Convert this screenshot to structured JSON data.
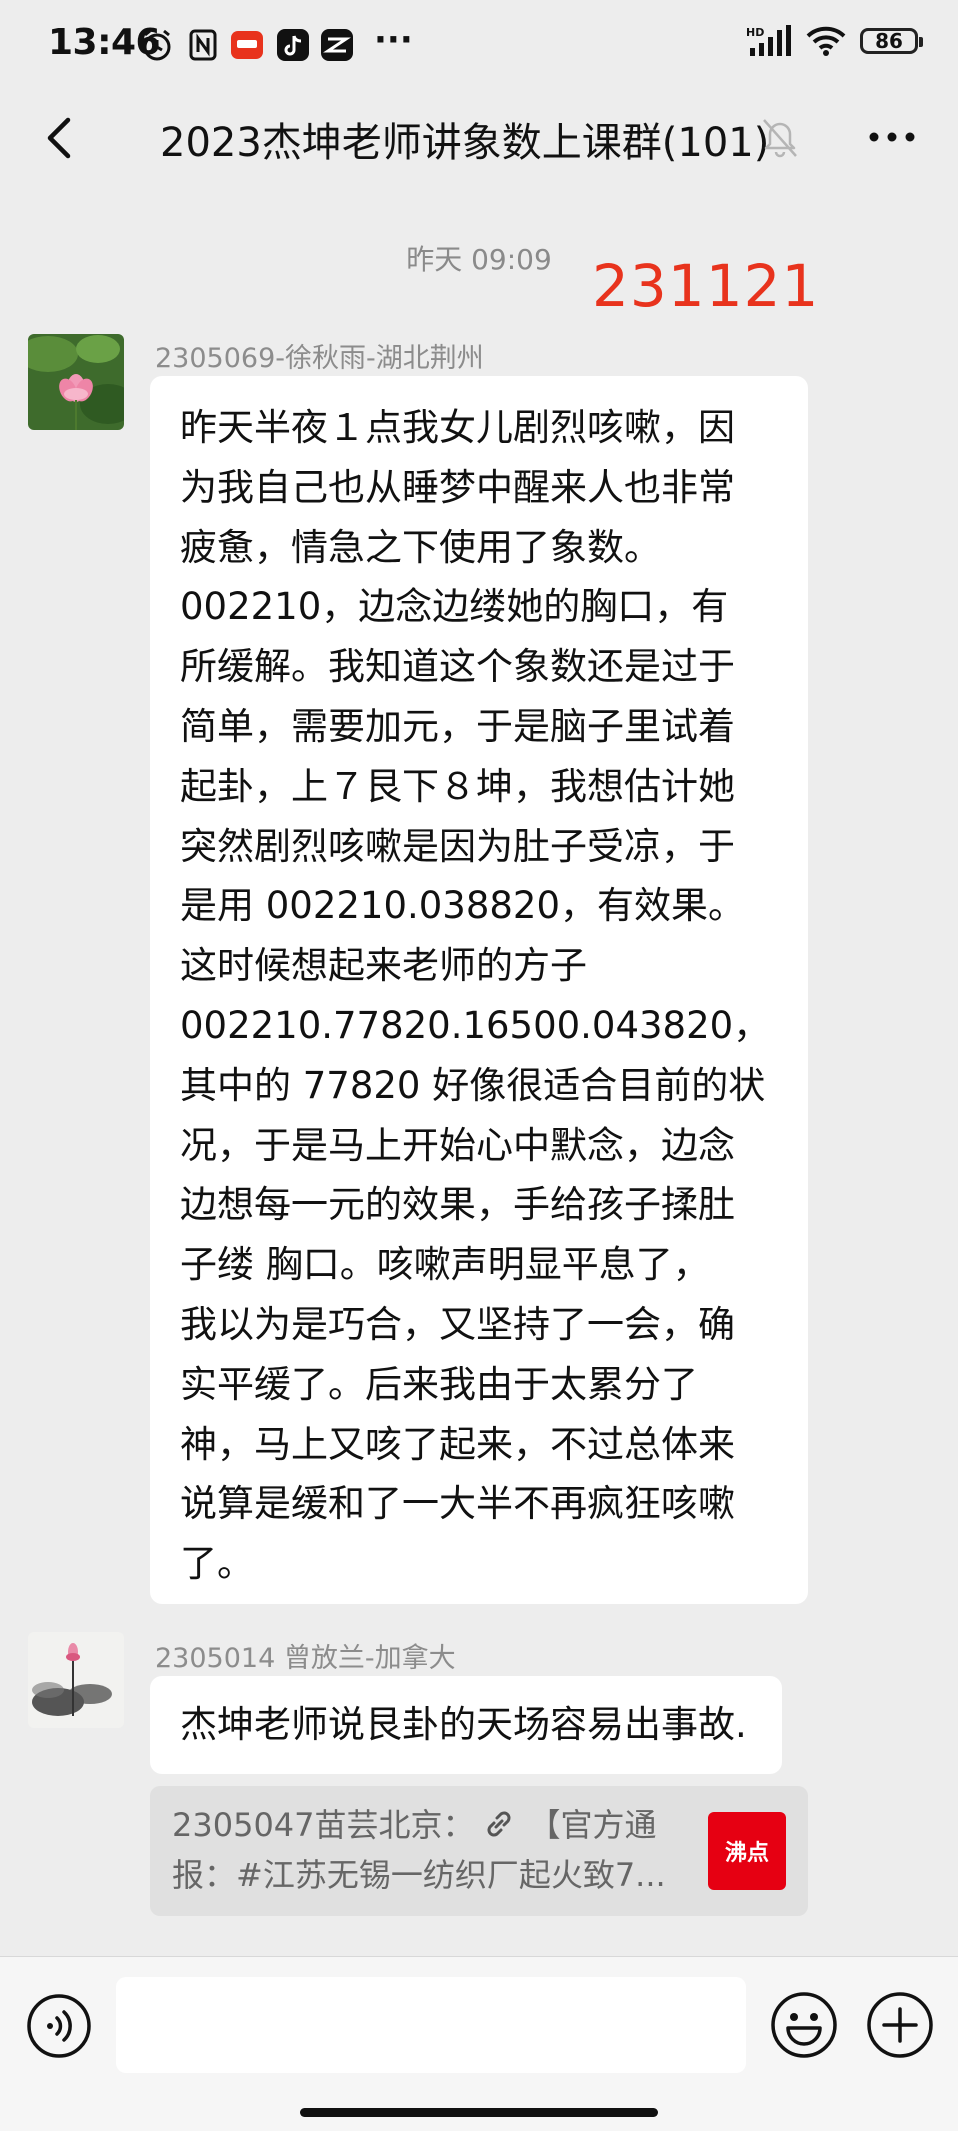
{
  "status_bar": {
    "time": "13:46",
    "battery": "86",
    "network": "HD"
  },
  "nav": {
    "title": "2023杰坤老师讲象数上课群(101)"
  },
  "chat": {
    "timestamp": "昨天 09:09",
    "red_code": "231121",
    "messages": [
      {
        "sender": "2305069-徐秋雨-湖北荆州",
        "lines": [
          "昨天半夜１点我女儿剧烈咳嗽，因",
          "为我自己也从睡梦中醒来人也非常",
          "疲惫，情急之下使用了象数。",
          "002210，边念边缕她的胸口，有",
          "所缓解。我知道这个象数还是过于",
          "简单，需要加元，于是脑子里试着",
          "起卦，上７艮下８坤，我想估计她",
          "突然剧烈咳嗽是因为肚子受凉，于",
          "是用 002210.038820，有效果。",
          "这时候想起来老师的方子",
          "002210.77820.16500.043820，",
          "其中的 77820 好像很适合目前的状",
          "况，于是马上开始心中默念，边念",
          "边想每一元的效果，手给孩子揉肚",
          "子缕 胸口。咳嗽声明显平息了，",
          "我以为是巧合，又坚持了一会，确",
          "实平缓了。后来我由于太累分了",
          "神，马上又咳了起来，不过总体来",
          "说算是缓和了一大半不再疯狂咳嗽",
          "了。"
        ]
      },
      {
        "sender": "2305014  曾放兰-加拿大",
        "lines": [
          "杰坤老师说艮卦的天场容易出事故."
        ]
      }
    ],
    "quote": {
      "line1": "2305047苗芸北京：",
      "line1_rest": "【官方通",
      "line2": "报：#江苏无锡一纺织厂起火致7...",
      "thumb_label": "沸点"
    }
  },
  "icons": {
    "back": "chevron-left-icon",
    "mute": "bell-off-icon",
    "more": "more-dots-icon",
    "link": "link-icon",
    "voice": "voice-icon",
    "emoji": "emoji-icon",
    "plus": "plus-icon"
  },
  "colors": {
    "background": "#ededed",
    "bubble": "#ffffff",
    "red_code": "#e8331d",
    "quote_bg": "#e0e0e0"
  }
}
